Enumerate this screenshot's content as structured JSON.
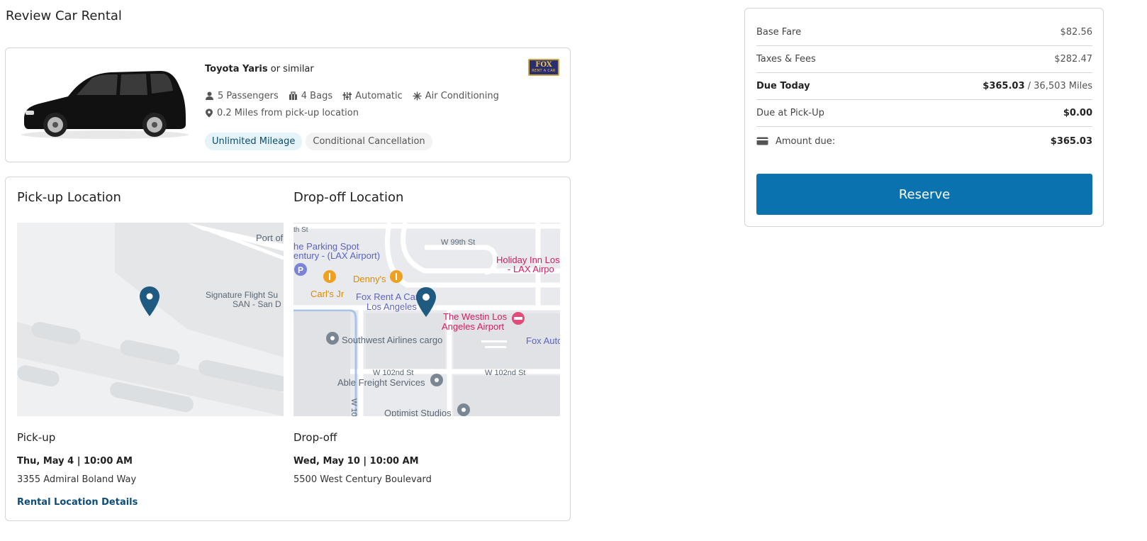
{
  "page": {
    "title": "Review Car Rental"
  },
  "car": {
    "model": "Toyota Yaris",
    "similar": "or similar",
    "brand_logo_line1": "FOX",
    "brand_logo_line2": "RENT A CAR",
    "features": [
      {
        "icon": "person-icon",
        "label": "5 Passengers"
      },
      {
        "icon": "bag-icon",
        "label": "4 Bags"
      },
      {
        "icon": "transmission-icon",
        "label": "Automatic"
      },
      {
        "icon": "snowflake-icon",
        "label": "Air Conditioning"
      }
    ],
    "distance": "0.2 Miles from pick-up location",
    "chips": [
      "Unlimited Mileage",
      "Conditional Cancellation"
    ]
  },
  "pickup": {
    "heading": "Pick-up Location",
    "label": "Pick-up",
    "datetime": "Thu, May 4 | 10:00 AM",
    "address": "3355 Admiral Boland Way",
    "link": "Rental Location Details",
    "map_labels": [
      "Port of",
      "Signature Flight Su",
      "SAN - San D"
    ]
  },
  "dropoff": {
    "heading": "Drop-off Location",
    "label": "Drop-off",
    "datetime": "Wed, May 10 | 10:00 AM",
    "address": "5500 West Century Boulevard",
    "map_labels": {
      "street_top": "th St",
      "w99": "W 99th St",
      "parking1": "he Parking Spot",
      "parking2": "entury - (LAX Airport)",
      "holiday1": "Holiday Inn Los",
      "holiday2": "- LAX Airpo",
      "dennys": "Denny's",
      "carls": "Carl's Jr",
      "fox1": "Fox Rent A Car",
      "fox2": "Los Angeles",
      "westin1": "The Westin Los",
      "westin2": "Angeles Airport",
      "southwest": "Southwest Airlines cargo",
      "foxauto": "Fox Auto",
      "w102a": "W 102nd St",
      "w102b": "W 102nd St",
      "able": "Able Freight Services",
      "optimist": "Optimist Studios",
      "w10": "W 10"
    }
  },
  "summary": {
    "base_fare_label": "Base Fare",
    "base_fare": "$82.56",
    "taxes_label": "Taxes & Fees",
    "taxes": "$282.47",
    "due_today_label": "Due Today",
    "due_today": "$365.03",
    "due_today_sep": " / ",
    "due_today_miles": "36,503 Miles",
    "due_pickup_label": "Due at Pick-Up",
    "due_pickup": "$0.00",
    "amount_due_label": "Amount due:",
    "amount_due": "$365.03",
    "reserve_label": "Reserve"
  },
  "colors": {
    "accent": "#0b72b0",
    "link": "#0d4d7a",
    "chip_blue": "#e6f4fa",
    "map_pin": "#1f5a80"
  }
}
